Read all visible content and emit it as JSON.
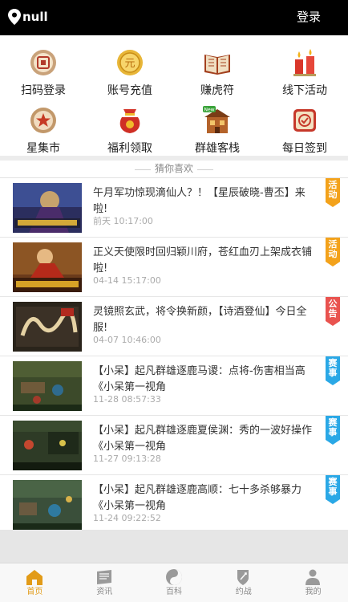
{
  "topbar": {
    "username": "null",
    "login_label": "登录"
  },
  "menu": [
    {
      "label": "扫码登录",
      "icon": "scan-login-icon"
    },
    {
      "label": "账号充值",
      "icon": "coin-recharge-icon"
    },
    {
      "label": "赚虎符",
      "icon": "book-icon"
    },
    {
      "label": "线下活动",
      "icon": "candle-icon"
    },
    {
      "label": "星集市",
      "icon": "star-seal-icon"
    },
    {
      "label": "福利领取",
      "icon": "lucky-bag-icon"
    },
    {
      "label": "群雄客栈",
      "icon": "inn-icon",
      "badge": "New"
    },
    {
      "label": "每日签到",
      "icon": "sign-in-icon"
    }
  ],
  "section_title": "猜你喜欢",
  "news": [
    {
      "title": "午月军功惊现滴仙人？！【星辰破晓-曹丕】来啦!",
      "time": "前天 10:17:00",
      "tag": "活动",
      "tag_color": "#f3a21b"
    },
    {
      "title": "正义天使限时回归颖川府，苍红血刃上架成衣铺啦!",
      "time": "04-14 15:17:00",
      "tag": "活动",
      "tag_color": "#f3a21b"
    },
    {
      "title": "灵镜照玄武，将令换新颜，【诗酒登仙】今日全服!",
      "time": "04-07 10:46:00",
      "tag": "公告",
      "tag_color": "#e9534f"
    },
    {
      "title": "【小呆】起凡群雄逐鹿马谡：点将-伤害相当高《小呆第一视角",
      "time": "11-28 08:57:33",
      "tag": "赛事",
      "tag_color": "#2aa8e6"
    },
    {
      "title": "【小呆】起凡群雄逐鹿夏侯渊：秀的一波好操作《小呆第一视角",
      "time": "11-27 09:13:28",
      "tag": "赛事",
      "tag_color": "#2aa8e6"
    },
    {
      "title": "【小呆】起凡群雄逐鹿高顺：七十多杀够暴力《小呆第一视角",
      "time": "11-24 09:22:52",
      "tag": "赛事",
      "tag_color": "#2aa8e6"
    }
  ],
  "tabs": [
    {
      "label": "首页",
      "icon": "home-icon",
      "active": true
    },
    {
      "label": "资讯",
      "icon": "news-icon",
      "active": false
    },
    {
      "label": "百科",
      "icon": "yinyang-icon",
      "active": false
    },
    {
      "label": "约战",
      "icon": "battle-icon",
      "active": false
    },
    {
      "label": "我的",
      "icon": "profile-icon",
      "active": false
    }
  ],
  "colors": {
    "accent": "#e29b18",
    "topbar": "#000000",
    "tab_inactive": "#8a8a8a"
  }
}
